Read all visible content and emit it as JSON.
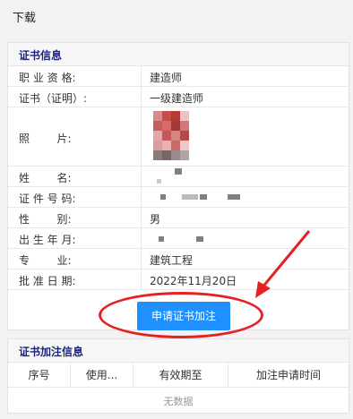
{
  "topbar": {
    "title": "下载"
  },
  "cert": {
    "heading": "证书信息",
    "rows": [
      {
        "label": "职 业 资 格:",
        "value": "建造师"
      },
      {
        "label": "证书（证明）:",
        "value": "一级建造师"
      },
      {
        "label": "照        片:",
        "value": ""
      },
      {
        "label": "姓        名:",
        "value": ""
      },
      {
        "label": "证 件 号 码:",
        "value": ""
      },
      {
        "label": "性        别:",
        "value": "男"
      },
      {
        "label": "出 生 年 月:",
        "value": ""
      },
      {
        "label": "专        业:",
        "value": "建筑工程"
      },
      {
        "label": "批 准 日 期:",
        "value": "2022年11月20日"
      }
    ],
    "apply_button": "申请证书加注"
  },
  "addon": {
    "heading": "证书加注信息",
    "columns": [
      "序号",
      "使用...",
      "有效期至",
      "加注申请时间"
    ],
    "empty_text": "无数据"
  },
  "colors": {
    "accent": "#1e90ff",
    "heading": "#1a237e",
    "annotation": "#e52222"
  }
}
